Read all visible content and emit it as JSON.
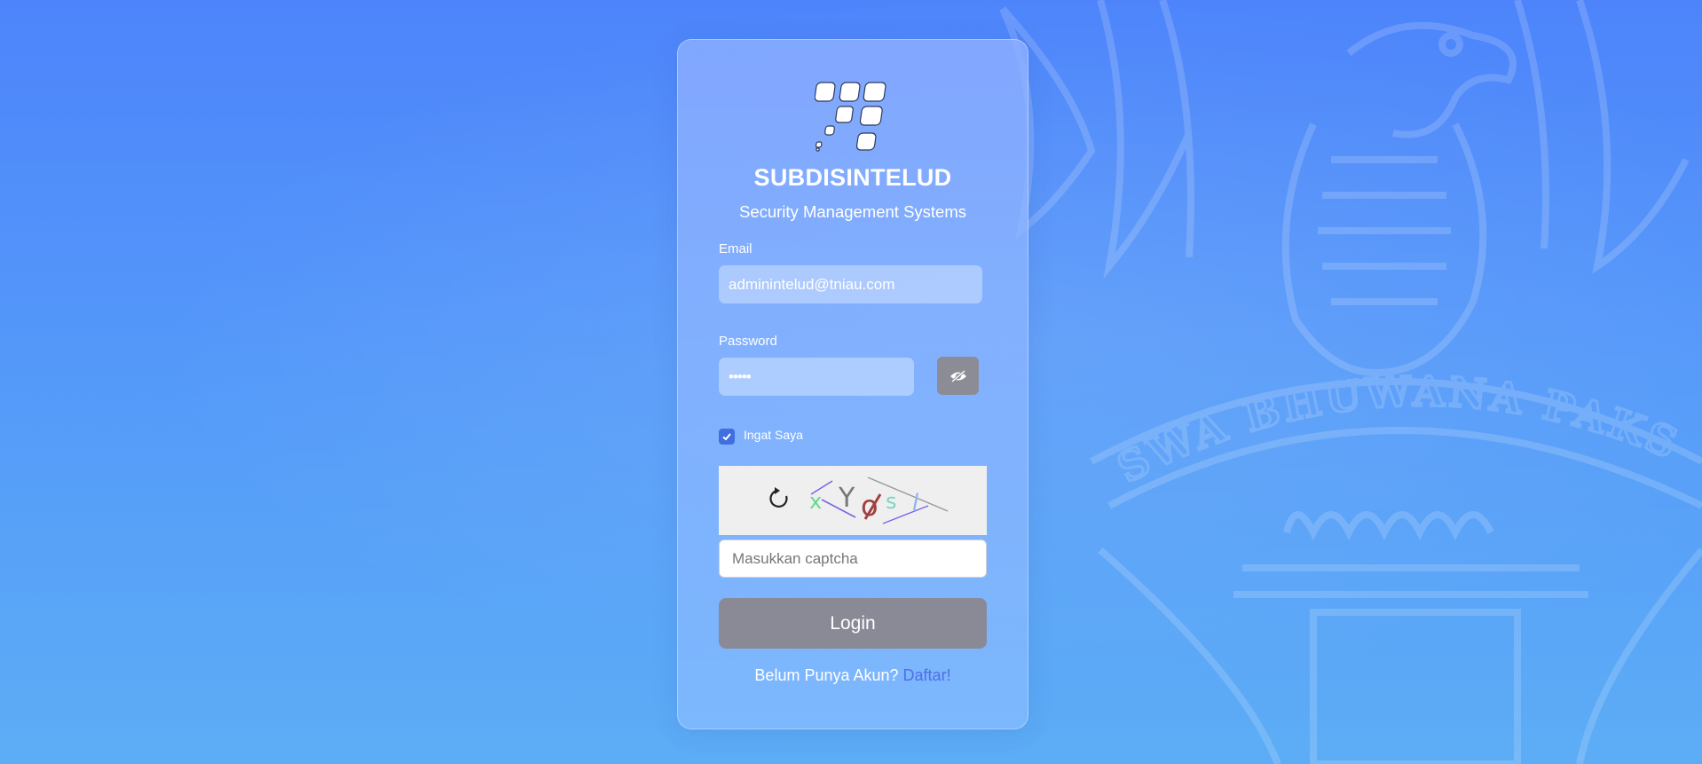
{
  "background": {
    "emblem_motto": "SWA BHUWANA PAKSA",
    "colors": {
      "top": "#4d84fb",
      "bottom": "#5dadf6"
    }
  },
  "brand": {
    "title": "SUBDISINTELUD",
    "subtitle": "Security Management Systems",
    "logo_icon": "squares-logo-icon"
  },
  "form": {
    "email_label": "Email",
    "email_value": "adminintelud@tniau.com",
    "password_label": "Password",
    "password_value": "•••••",
    "toggle_icon": "eye-slash-icon",
    "remember_label": "Ingat Saya",
    "remember_checked": true,
    "captcha": {
      "refresh_icon": "refresh-icon",
      "characters": [
        "x",
        "Y",
        "o",
        "s",
        "l"
      ],
      "placeholder": "Masukkan captcha"
    },
    "login_label": "Login"
  },
  "footer": {
    "prompt": "Belum Punya Akun?",
    "link": "Daftar!"
  },
  "colors": {
    "login_button": "#8a8a97",
    "link": "#4f6fe6",
    "checkbox": "#3f6fe0"
  }
}
